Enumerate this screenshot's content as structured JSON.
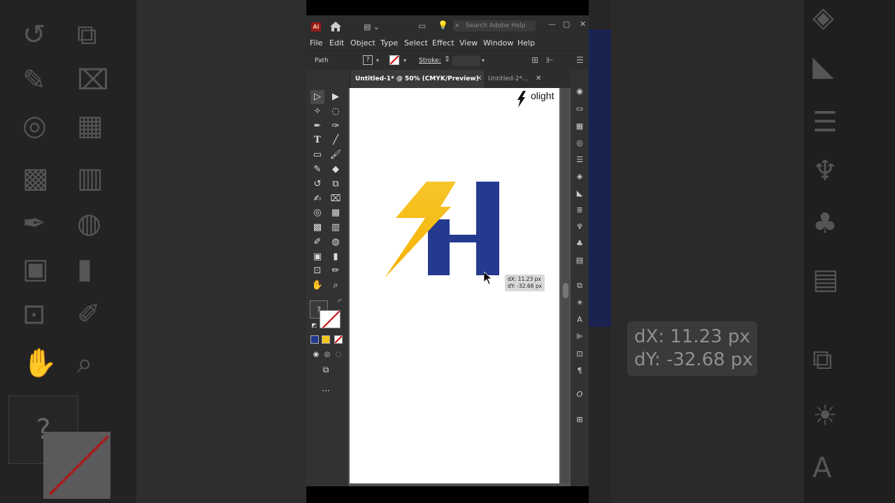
{
  "window": {
    "app_logo": "Ai",
    "search_placeholder": "Search Adobe Help"
  },
  "menu": [
    "File",
    "Edit",
    "Object",
    "Type",
    "Select",
    "Effect",
    "View",
    "Window",
    "Help"
  ],
  "control_bar": {
    "selection_type": "Path",
    "fill_label": "?",
    "stroke_label": "Stroke:"
  },
  "tabs": [
    {
      "label": "Untitled-1* @ 50% (CMYK/Preview)",
      "active": true
    },
    {
      "label": "Untitled-2*...",
      "active": false
    }
  ],
  "toolbox": {
    "fill_box": "?",
    "more": "..."
  },
  "artboard": {
    "brand_text": "olight",
    "logo_colors": {
      "bolt_top": "#f7c52a",
      "bolt_bottom": "#f5b301",
      "letter": "#233a8f"
    }
  },
  "measurement": {
    "dx": "dX: 11.23 px",
    "dy": "dY: -32.68 px"
  },
  "colors": {
    "app_chrome": "#2d2d2d",
    "panel": "#323232",
    "canvas": "#535353",
    "swatch_blue": "#233a8f",
    "swatch_yellow": "#f5c518"
  }
}
